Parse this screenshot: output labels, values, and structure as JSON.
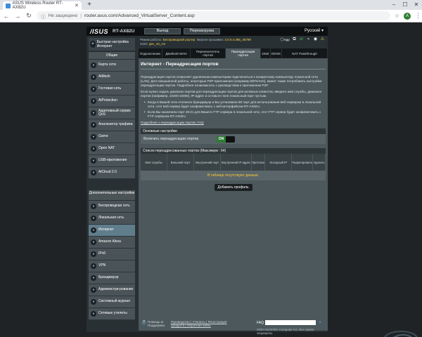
{
  "browser": {
    "tab_title": "ASUS Wireless Router RT-AX82U",
    "address_security": "Не защищено",
    "address_url": "router.asus.com/Advanced_VirtualServer_Content.asp",
    "avatar_letter": "A"
  },
  "router": {
    "logo": "/ISUS",
    "model": "RT-AX82U",
    "logout_label": "Выход",
    "reboot_label": "Перезагрузка",
    "language": "Русский",
    "info": {
      "line1_label": "Режим работы:",
      "line1_value": "Беспроводной роутер",
      "line1b_label": "Версия прошивки:",
      "line1b_value": "3.0.0.4.386_45789",
      "line2_label": "SSID:",
      "line2_value": "gec_10_cm"
    },
    "app_label": "App"
  },
  "sidebar": {
    "qis_label": "Быстрая настройка Интернет",
    "general_header": "Общие",
    "general_items": [
      {
        "label": "Карта сети",
        "icon": "map-icon"
      },
      {
        "label": "AiMesh",
        "icon": "mesh-icon"
      },
      {
        "label": "Гостевая сеть",
        "icon": "guest-icon"
      },
      {
        "label": "AiProtection",
        "icon": "shield-icon"
      },
      {
        "label": "Адаптивный сервис QoS",
        "icon": "qos-icon"
      },
      {
        "label": "Анализатор трафика",
        "icon": "traffic-icon"
      },
      {
        "label": "Game",
        "icon": "game-icon"
      },
      {
        "label": "Open NAT",
        "icon": "nat-icon"
      },
      {
        "label": "USB-приложение",
        "icon": "usb-icon"
      },
      {
        "label": "AiCloud 2.0",
        "icon": "cloud-icon"
      }
    ],
    "advanced_header": "Дополнительные настройки",
    "advanced_items": [
      {
        "label": "Беспроводная сеть",
        "icon": "wifi-icon"
      },
      {
        "label": "Локальная сеть",
        "icon": "lan-icon"
      },
      {
        "label": "Интернет",
        "icon": "globe-icon",
        "active": true
      },
      {
        "label": "Amazon Alexa",
        "icon": "alexa-icon"
      },
      {
        "label": "IPv6",
        "icon": "ipv6-icon"
      },
      {
        "label": "VPN",
        "icon": "vpn-icon"
      },
      {
        "label": "Брандмауэр",
        "icon": "firewall-icon"
      },
      {
        "label": "Администри-рование",
        "icon": "admin-icon"
      },
      {
        "label": "Системный журнал",
        "icon": "log-icon"
      },
      {
        "label": "Сетевые утилиты",
        "icon": "tools-icon"
      }
    ]
  },
  "tabs": [
    {
      "label": "Подключение"
    },
    {
      "label": "Двойной WAN"
    },
    {
      "label": "Переключатель портов"
    },
    {
      "label": "Переадресация портов",
      "active": true
    },
    {
      "label": "DMZ"
    },
    {
      "label": "DDNS"
    },
    {
      "label": "NAT Passthrough"
    }
  ],
  "main": {
    "title": "Интернет - Переадресация портов",
    "desc1": "Переадресация портов позволяет удаленным компьютерам подключаться к конкретному компьютеру локальной сети (LAN). Для повышенной работы, некоторые P2P-приложения (например BitTorrent), может также потребовать настройки переадресации портов. Подробнее ознакомьтесь с руководством к приложению P2P.",
    "desc2": "Если нужно задать диапазон портов для переадресации портов для активных клиентов, введите имя службы, диапазон портов (например, 10200:10300), IP-адрес и оставьте поле локальный порт пустым.",
    "bullet1": "Когда в Вашей сети отключен брандмауэр и Вы установили 80 порт для использования веб-сервером в локальной сети, этот веб-сервер будет конфликтовать с веб-интерфейсом RT-AX82U.",
    "bullet2": "Если Вы назначили порт 20:21 для Вашего FTP сервера в локальной сети, этот FTP сервер будет конфликтовать с FTP сервером RT-AX82U.",
    "faq_link": "Подробнее о переадресации портов: FAQ",
    "basic_header": "Основные настройки",
    "enable_label": "Включить переадресацию портов",
    "toggle_on": "ON",
    "list_header": "Список переадресованных портов (Максимум : 64)",
    "columns": [
      "Имя службы",
      "Внешний порт",
      "Внутренний порт",
      "Внутренний IP-адрес",
      "Протокол",
      "Исходный IP",
      "Редактировать",
      "Удалить"
    ],
    "empty_text": "В таблице отсутствуют данные.",
    "add_button": "Добавить профиль"
  },
  "footer": {
    "help_label": "Помощь & Поддержка",
    "links_line1": "Руководство | Утилиты | Регистрация",
    "links_line2": "продукта | Обратная связь",
    "faq_label": "FAQ",
    "copyright": "2020 ASUSTeK Computer Inc. Все права защищены."
  }
}
